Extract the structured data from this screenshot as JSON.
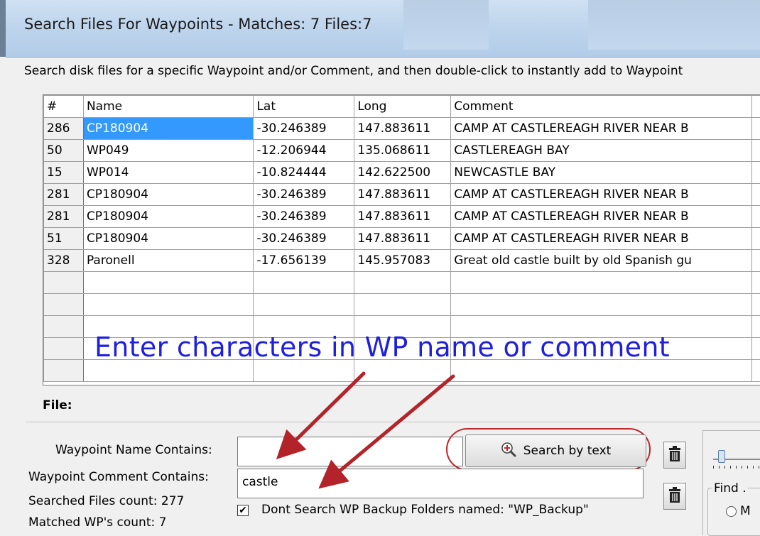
{
  "window": {
    "title": "Search Files For Waypoints - Matches: 7 Files:7"
  },
  "instruction": "Search disk files for a specific Waypoint and/or Comment, and then double-click to instantly add to Waypoint",
  "grid": {
    "columns": [
      "#",
      "Name",
      "Lat",
      "Long",
      "Comment"
    ],
    "rows": [
      {
        "num": "286",
        "name": "CP180904",
        "lat": "-30.246389",
        "long": "147.883611",
        "comment": "CAMP AT CASTLEREAGH RIVER NEAR B",
        "selected": true
      },
      {
        "num": "50",
        "name": "WP049",
        "lat": "-12.206944",
        "long": "135.068611",
        "comment": "CASTLEREAGH BAY"
      },
      {
        "num": "15",
        "name": "WP014",
        "lat": "-10.824444",
        "long": "142.622500",
        "comment": "NEWCASTLE BAY"
      },
      {
        "num": "281",
        "name": "CP180904",
        "lat": "-30.246389",
        "long": "147.883611",
        "comment": "CAMP AT CASTLEREAGH RIVER NEAR B"
      },
      {
        "num": "281",
        "name": "CP180904",
        "lat": "-30.246389",
        "long": "147.883611",
        "comment": "CAMP AT CASTLEREAGH RIVER NEAR B"
      },
      {
        "num": "51",
        "name": "CP180904",
        "lat": "-30.246389",
        "long": "147.883611",
        "comment": "CAMP AT CASTLEREAGH RIVER NEAR B"
      },
      {
        "num": "328",
        "name": "Paronell",
        "lat": "-17.656139",
        "long": "145.957083",
        "comment": "Great old castle built by old Spanish gu"
      }
    ]
  },
  "annotation": {
    "text": "Enter characters in WP name or comment",
    "color": "#1f1fe0",
    "arrow_color": "#b3232a"
  },
  "file_label": "File:",
  "search": {
    "name_label": "Waypoint Name Contains:",
    "name_value": "",
    "comment_label": "Waypoint Comment Contains:",
    "comment_value": "castle",
    "button_label": "Search by text",
    "searched_files": "Searched Files count: 277",
    "matched_wps": "Matched WP's count: 7",
    "backup_checkbox_label": "Dont Search WP Backup Folders named: \"WP_Backup\"",
    "backup_checked": true
  },
  "right_panel": {
    "group_label": "Find .",
    "radio_label": "M"
  },
  "icons": {
    "search_button": "magnifier-plus-icon",
    "clear_name": "trash-can-icon",
    "clear_comment": "trash-can-icon"
  }
}
